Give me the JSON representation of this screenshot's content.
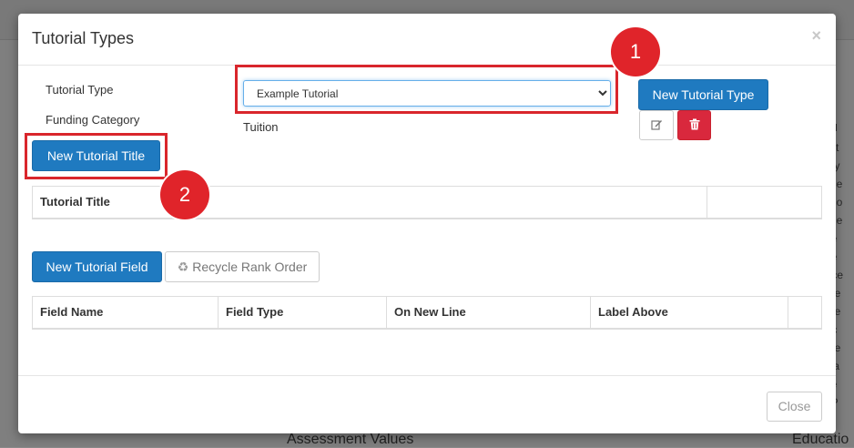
{
  "background": {
    "side_heading": "alu",
    "side_lines": [
      "e St",
      "e Ty",
      "e Ce",
      "e Co",
      "e Re",
      "nce",
      "nce",
      "ence",
      "ome",
      "ome",
      "anc",
      "ome",
      "Cha",
      "nce",
      "al P"
    ],
    "bottom_left": "Assessment Values",
    "bottom_right": "Educatio"
  },
  "modal": {
    "title": "Tutorial Types",
    "close_icon": "×",
    "tutorial_type_label": "Tutorial Type",
    "funding_category_label": "Funding Category",
    "tutorial_type_selected": "Example Tutorial",
    "tutorial_type_options": [
      "Example Tutorial"
    ],
    "funding_category_value": "Tuition",
    "new_tutorial_type_button": "New Tutorial Type",
    "edit_icon": "edit-icon",
    "delete_icon": "trash-icon",
    "new_tutorial_title_button": "New Tutorial Title",
    "titles_table": {
      "headers": [
        "Tutorial Title",
        ""
      ]
    },
    "new_tutorial_field_button": "New Tutorial Field",
    "recycle_rank_order_button": "Recycle Rank Order",
    "fields_table": {
      "headers": [
        "Field Name",
        "Field Type",
        "On New Line",
        "Label Above",
        ""
      ]
    },
    "footer_close_button": "Close"
  },
  "annotations": {
    "callout_1": "1",
    "callout_2": "2",
    "color": "#e0242a"
  },
  "colors": {
    "primary": "#1f7ac0",
    "danger": "#d9283d",
    "callout": "#d9262c"
  }
}
